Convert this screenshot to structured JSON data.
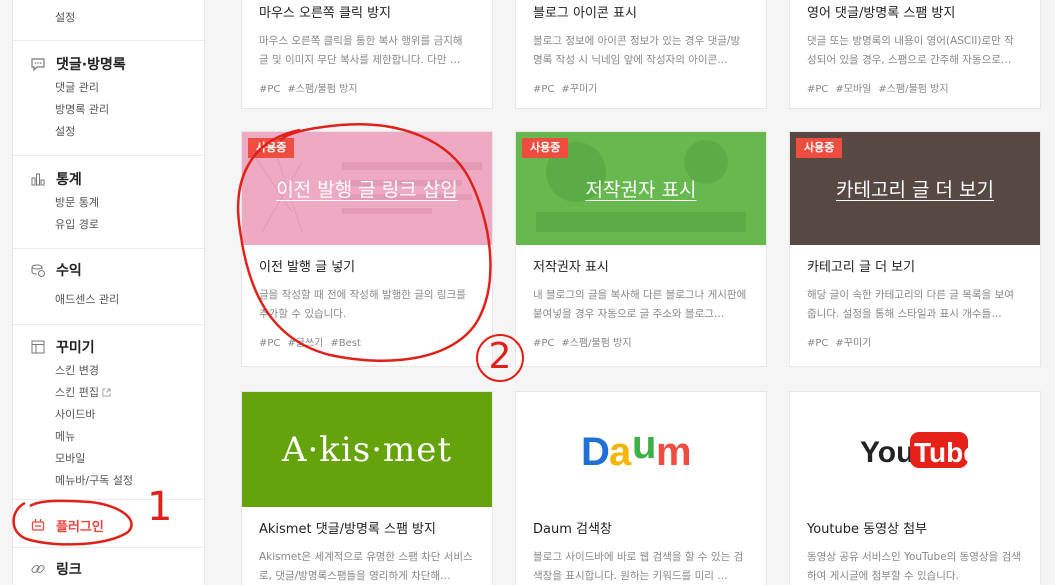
{
  "sidebar": {
    "top_partial": "설정",
    "groups": [
      {
        "title": "댓글·방명록",
        "icon": "comment-icon",
        "items": [
          "댓글 관리",
          "방명록 관리",
          "설정"
        ]
      },
      {
        "title": "통계",
        "icon": "bar-chart-icon",
        "items": [
          "방문 통계",
          "유입 경로"
        ]
      },
      {
        "title": "수익",
        "icon": "coins-icon",
        "items": [
          "애드센스 관리"
        ]
      },
      {
        "title": "꾸미기",
        "icon": "layout-icon",
        "items": [
          "스킨 변경",
          "스킨 편집",
          "사이드바",
          "메뉴",
          "모바일",
          "메뉴바/구독 설정"
        ]
      }
    ],
    "plugin": "플러그인",
    "link": "링크"
  },
  "cards": [
    {
      "title": "마우스 오른쪽 클릭 방지",
      "desc": "마우스 오른쪽 클릭을 통한 복사 행위를 금지해 글 및 이미지 무단 복사를 제한합니다. 다만 …",
      "tags": [
        "#PC",
        "#스팸/불펌 방지"
      ]
    },
    {
      "title": "블로그 아이콘 표시",
      "desc": "블로그 정보에 아이콘 정보가 있는 경우 댓글/방명록 작성 시 닉네임 앞에 작성자의 아이콘…",
      "tags": [
        "#PC",
        "#꾸미기"
      ]
    },
    {
      "title": "영어 댓글/방명록 스팸 방지",
      "desc": "댓글 또는 방명록의 내용이 영어(ASCII)로만 작성되어 있을 경우, 스팸으로 간주해 자동으로…",
      "tags": [
        "#PC",
        "#모바일",
        "#스팸/불펌 방지"
      ]
    },
    {
      "badge": "사용중",
      "thumb_title": "이전 발행 글 링크 삽입",
      "title": "이전 발행 글 넣기",
      "desc": "글을 작성할 때 전에 작성해 발행한 글의 링크를 추가할 수 있습니다.",
      "tags": [
        "#PC",
        "#글쓰기",
        "#Best"
      ]
    },
    {
      "badge": "사용중",
      "thumb_title": "저작권자 표시",
      "title": "저작권자 표시",
      "desc": "내 블로그의 글을 복사해 다른 블로그나 게시판에 붙여넣을 경우 자동으로 글 주소와 블로그…",
      "tags": [
        "#PC",
        "#스팸/불펌 방지"
      ]
    },
    {
      "badge": "사용중",
      "thumb_title": "카테고리 글 더 보기",
      "title": "카테고리 글 더 보기",
      "desc": "해당 글이 속한 카테고리의 다른 글 목록을 보여줍니다. 설정을 통해 스타일과 표시 개수들…",
      "tags": [
        "#PC",
        "#꾸미기"
      ]
    },
    {
      "thumb_title": "A·kis·met",
      "title": "Akismet 댓글/방명록 스팸 방지",
      "desc": "Akismet은 세계적으로 유명한 스팸 차단 서비스로, 댓글/방명록스팸들을 영리하게 차단해…",
      "tags": []
    },
    {
      "thumb_title": "Daum",
      "title": "Daum 검색창",
      "desc": "블로그 사이드바에 바로 웹 검색을 할 수 있는 검색창을 표시합니다. 원하는 키워드를 미리 …",
      "tags": []
    },
    {
      "thumb_title": "YouTube",
      "title": "Youtube 동영상 첨부",
      "desc": "동영상 공유 서비스인 YouTube의 동영상을 검색하여 게시글에 첨부할 수 있습니다.",
      "tags": []
    }
  ],
  "annotations": {
    "one": "1",
    "two": "2"
  },
  "colors": {
    "accent": "#ef4d3f",
    "pink": "#eeaac2",
    "green": "#66b84f",
    "brown": "#574844",
    "akismet": "#65a30d"
  }
}
